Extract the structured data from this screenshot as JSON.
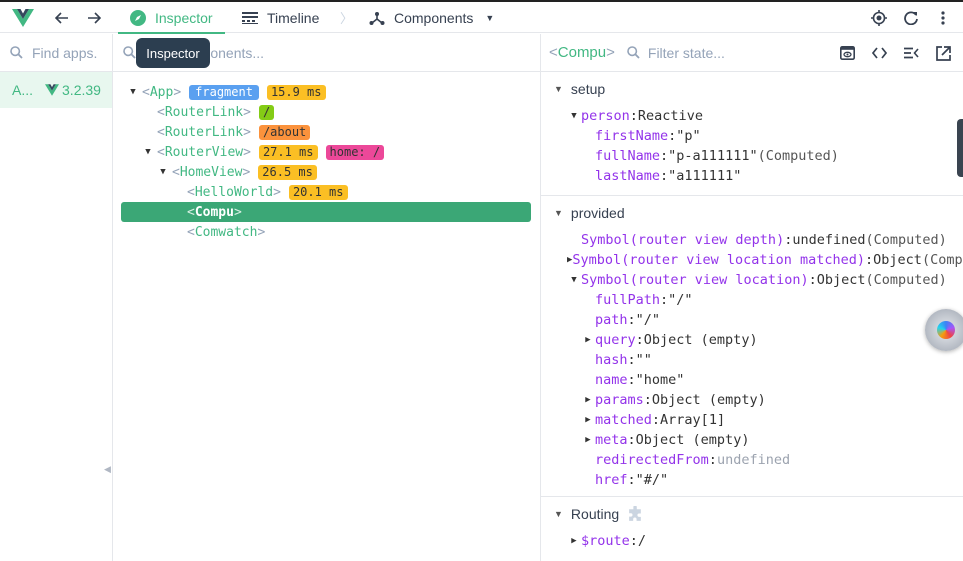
{
  "topbar": {
    "tabs": [
      {
        "label": "Inspector",
        "icon": "compass-icon",
        "active": true
      },
      {
        "label": "Timeline",
        "icon": "timeline-icon",
        "active": false
      },
      {
        "label": "Components",
        "icon": "component-tree-icon",
        "active": false,
        "dropdown": true
      }
    ],
    "right_icons": [
      "target-icon",
      "refresh-icon",
      "more-vert-icon"
    ]
  },
  "tooltip": "Inspector",
  "apps": {
    "search_placeholder": "Find apps...",
    "search_visible": "Find apps.",
    "items": [
      {
        "name": "A...",
        "version": "3.2.39"
      }
    ]
  },
  "tree": {
    "search_placeholder": "Find components...",
    "nodes": [
      {
        "name": "App",
        "depth": 0,
        "arrow": "down",
        "badges": [
          {
            "text": "fragment",
            "kind": "frag"
          },
          {
            "text": "15.9 ms",
            "kind": "ms"
          }
        ]
      },
      {
        "name": "RouterLink",
        "depth": 1,
        "arrow": "",
        "badges": [
          {
            "text": "/",
            "kind": "lime"
          }
        ]
      },
      {
        "name": "RouterLink",
        "depth": 1,
        "arrow": "",
        "badges": [
          {
            "text": "/about",
            "kind": "orange"
          }
        ]
      },
      {
        "name": "RouterView",
        "depth": 1,
        "arrow": "down",
        "badges": [
          {
            "text": "27.1 ms",
            "kind": "ms"
          },
          {
            "text": "home: /",
            "kind": "pink"
          }
        ]
      },
      {
        "name": "HomeView",
        "depth": 2,
        "arrow": "down",
        "badges": [
          {
            "text": "26.5 ms",
            "kind": "ms"
          }
        ]
      },
      {
        "name": "HelloWorld",
        "depth": 3,
        "arrow": "",
        "badges": [
          {
            "text": "20.1 ms",
            "kind": "ms"
          }
        ]
      },
      {
        "name": "Compu",
        "depth": 3,
        "arrow": "",
        "selected": true,
        "badges": []
      },
      {
        "name": "Comwatch",
        "depth": 3,
        "arrow": "",
        "badges": []
      }
    ]
  },
  "state": {
    "component_name": "Compu",
    "filter_placeholder": "Filter state...",
    "tools": [
      "eye-screen-icon",
      "code-icon",
      "collapse-list-icon",
      "open-external-icon"
    ],
    "sections": [
      {
        "title": "setup",
        "rows": [
          {
            "indent": 0,
            "arrow": "down",
            "key": "person",
            "value": "Reactive"
          },
          {
            "indent": 1,
            "arrow": "",
            "key": "firstName",
            "value": "\"p\""
          },
          {
            "indent": 1,
            "arrow": "",
            "key": "fullName",
            "value": "\"p-a111111\"",
            "note": "(Computed)"
          },
          {
            "indent": 1,
            "arrow": "",
            "key": "lastName",
            "value": "\"a111111\""
          }
        ]
      },
      {
        "title": "provided",
        "rows": [
          {
            "indent": 0,
            "arrow": "",
            "key": "Symbol(router view depth)",
            "value": "undefined",
            "note": "(Computed)"
          },
          {
            "indent": 0,
            "arrow": "right",
            "key": "Symbol(router view location matched)",
            "value": "Object",
            "note": "(Computed)"
          },
          {
            "indent": 0,
            "arrow": "down",
            "key": "Symbol(router view location)",
            "value": "Object",
            "note": "(Computed)"
          },
          {
            "indent": 1,
            "arrow": "",
            "key": "fullPath",
            "value": "\"/\""
          },
          {
            "indent": 1,
            "arrow": "",
            "key": "path",
            "value": "\"/\""
          },
          {
            "indent": 1,
            "arrow": "right",
            "key": "query",
            "value": "Object (empty)"
          },
          {
            "indent": 1,
            "arrow": "",
            "key": "hash",
            "value": "\"\""
          },
          {
            "indent": 1,
            "arrow": "",
            "key": "name",
            "value": "\"home\""
          },
          {
            "indent": 1,
            "arrow": "right",
            "key": "params",
            "value": "Object (empty)"
          },
          {
            "indent": 1,
            "arrow": "right",
            "key": "matched",
            "value": "Array[1]"
          },
          {
            "indent": 1,
            "arrow": "right",
            "key": "meta",
            "value": "Object (empty)"
          },
          {
            "indent": 1,
            "arrow": "",
            "key": "redirectedFrom",
            "value": "undefined",
            "muted": true
          },
          {
            "indent": 1,
            "arrow": "",
            "key": "href",
            "value": "\"#/\""
          }
        ]
      },
      {
        "title": "Routing",
        "plugin_icon": true,
        "rows": [
          {
            "indent": 0,
            "arrow": "right",
            "key": "$route",
            "value": "/"
          }
        ]
      }
    ]
  },
  "colors": {
    "accent": "#42b883",
    "selected_row": "#3ba776",
    "key": "#9333ea",
    "tooltip_bg": "#2c3e50"
  }
}
